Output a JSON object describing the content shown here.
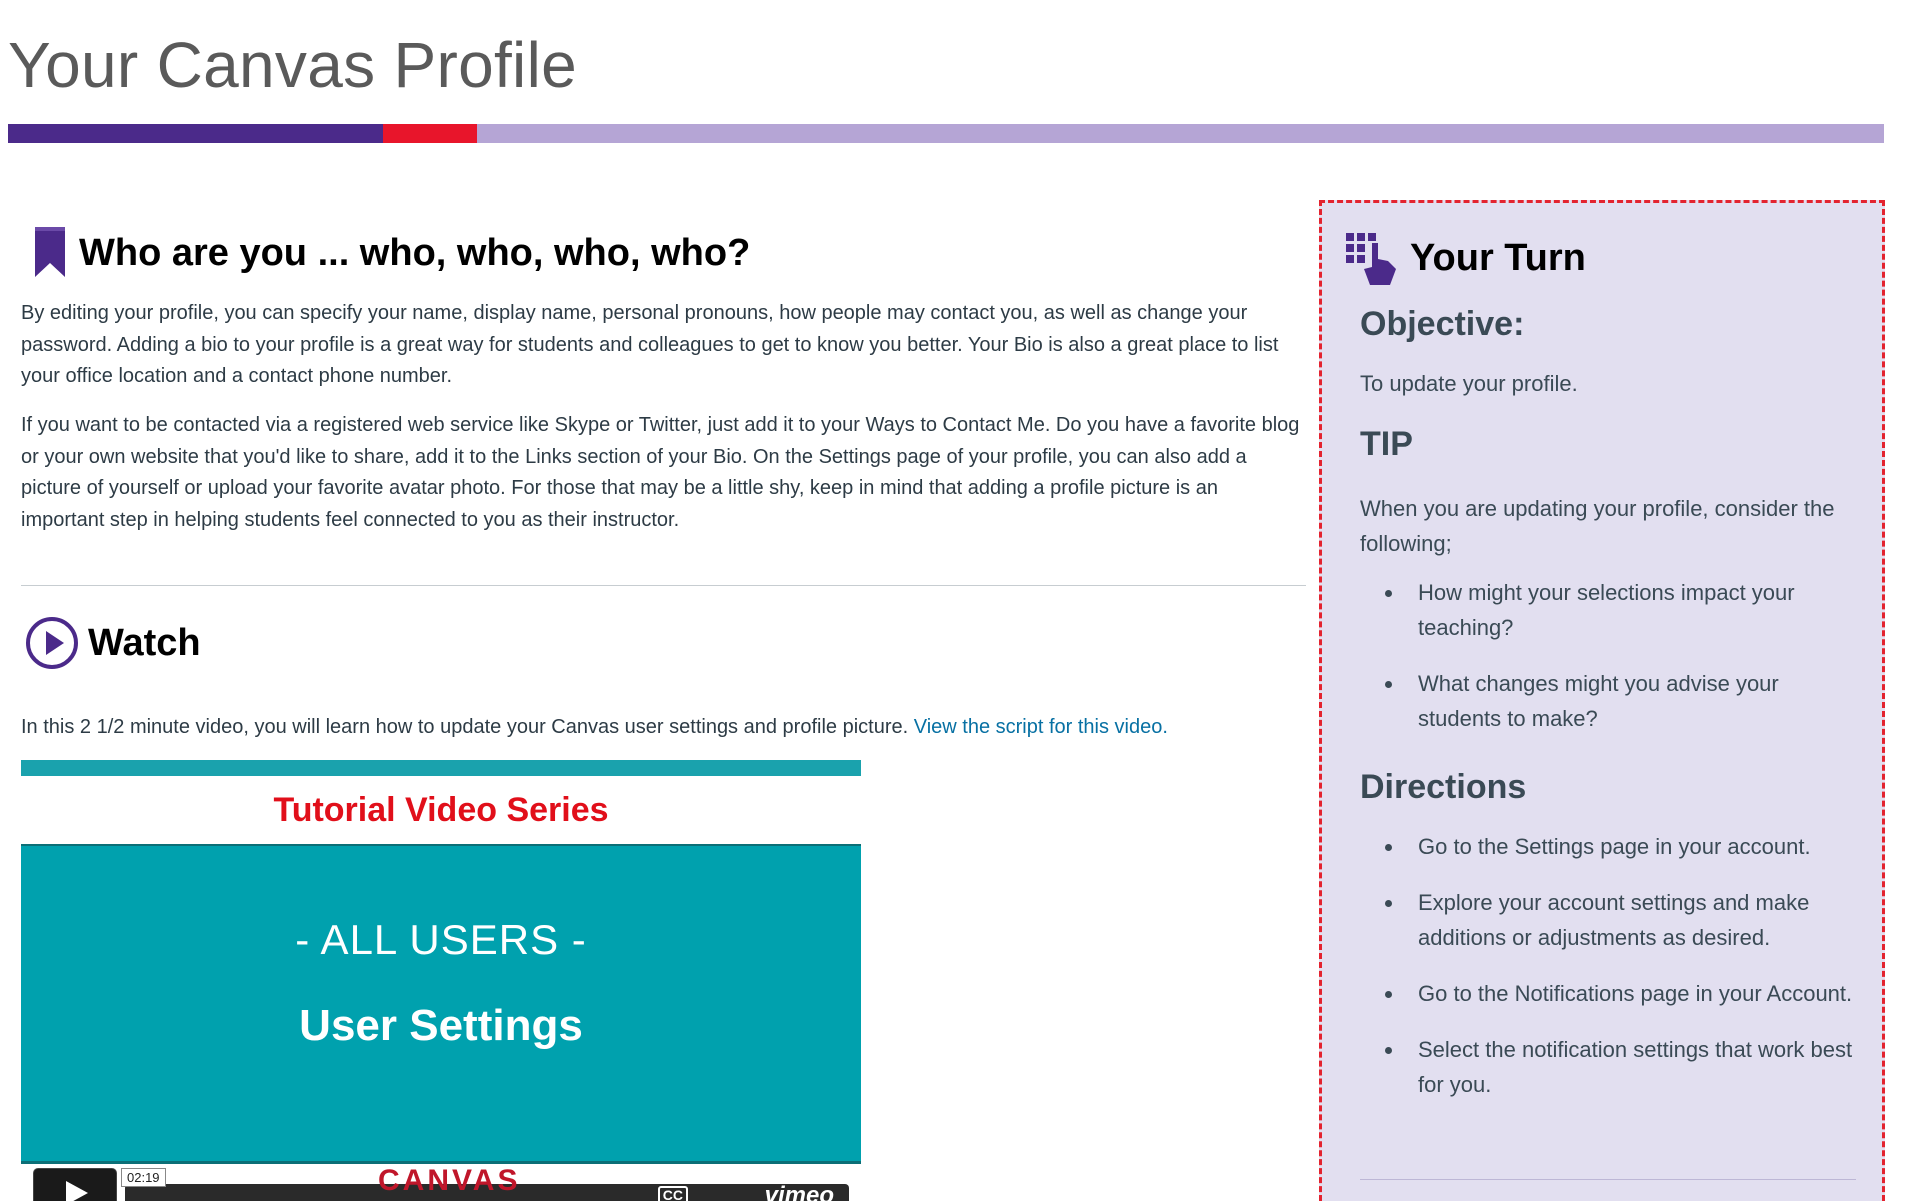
{
  "page": {
    "title": "Your Canvas Profile"
  },
  "colors": {
    "progress_done": "#4b2a8a",
    "progress_current": "#e8152b",
    "progress_rest": "#b5a5d5",
    "link": "#0770a3",
    "sidebar_bg": "#e2dff0",
    "sidebar_border": "#e3232f"
  },
  "progress": {
    "completed_fraction": 0.2,
    "current_fraction": 0.05
  },
  "who": {
    "icon": "bookmark-icon",
    "heading": "Who are you ... who, who, who, who?",
    "para1": "By editing your profile, you can specify your name, display name, personal pronouns, how people may contact you, as well as change your password. Adding a bio to your profile is a great way for students and colleagues to get to know you better. Your Bio is also a great place to list your office location and a contact phone number.",
    "para2": "If you want to be contacted via a registered web service like Skype or Twitter, just add it to your Ways to Contact Me. Do you have a favorite blog or your own website that you'd like to share, add it to the Links section of your Bio. On the Settings page of your profile, you can also add a picture of yourself or upload your favorite avatar photo. For those that may be a little shy, keep in mind that adding a profile picture is an important step in helping students feel connected to you as their instructor."
  },
  "watch": {
    "icon": "play-circle-icon",
    "heading": "Watch",
    "intro": "In this 2 1/2 minute video, you will learn how to update your Canvas user settings and profile picture.",
    "link_text": "View the script for this video."
  },
  "video": {
    "series_title": "Tutorial Video Series",
    "audience": "- ALL USERS -",
    "topic": "User Settings",
    "time": "02:19",
    "brand": "CANVAS",
    "cc": "CC",
    "provider": "vimeo"
  },
  "your_turn": {
    "icon": "hand-grid-icon",
    "heading": "Your Turn",
    "objective_heading": "Objective:",
    "objective_text": "To update your profile.",
    "tip_heading": "TIP",
    "tip_text": "When you are updating your profile, consider the following;",
    "tip_items": [
      "How might your selections impact your teaching?",
      "What changes might you advise your students to make?"
    ],
    "directions_heading": "Directions",
    "directions": [
      "Go to the Settings page in your account.",
      "Explore your account settings and make additions or adjustments as desired.",
      "Go to the Notifications page in your Account.",
      "Select the notification settings that work best for you."
    ]
  }
}
